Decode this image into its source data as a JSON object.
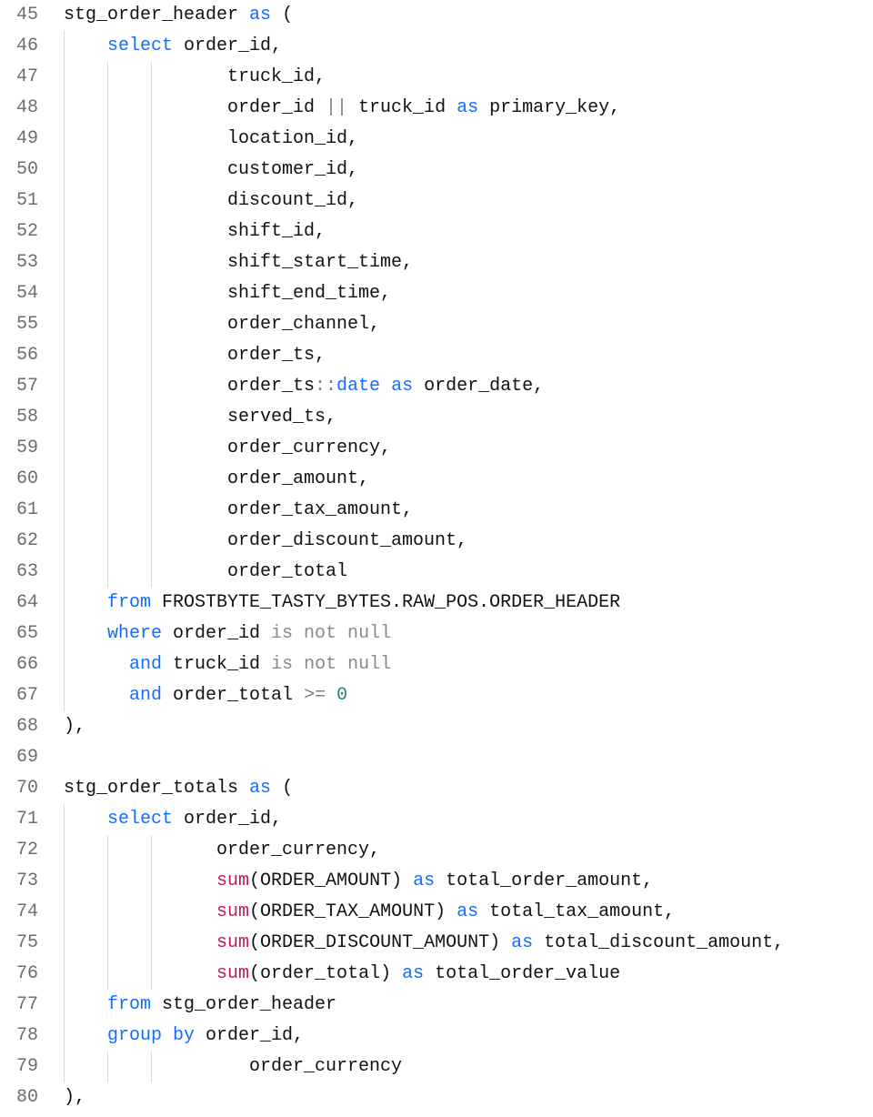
{
  "language": "sql",
  "colors": {
    "keyword": "#126dff",
    "function": "#c2185b",
    "number": "#1d8a7b",
    "null": "#8a8a8a",
    "operator": "#7d7d7d",
    "text": "#111111",
    "gutter": "#6d6d6d",
    "gutter_active": "#1d8a7b",
    "indent_guide": "#d7d7d7"
  },
  "lines": [
    {
      "n": 45,
      "guide": [],
      "tokens": [
        [
          "id",
          "stg_order_header "
        ],
        [
          "kw",
          "as"
        ],
        [
          "punc",
          " ("
        ]
      ]
    },
    {
      "n": 46,
      "guide": [
        1
      ],
      "tokens": [
        [
          "kw",
          "select"
        ],
        [
          "id",
          " order_id"
        ],
        [
          "punc",
          ","
        ]
      ]
    },
    {
      "n": 47,
      "guide": [
        1,
        1,
        1
      ],
      "tokens": [
        [
          "id",
          "   truck_id"
        ],
        [
          "punc",
          ","
        ]
      ]
    },
    {
      "n": 48,
      "guide": [
        1,
        1,
        1
      ],
      "tokens": [
        [
          "id",
          "   order_id "
        ],
        [
          "op",
          "||"
        ],
        [
          "id",
          " truck_id "
        ],
        [
          "kw",
          "as"
        ],
        [
          "id",
          " primary_key"
        ],
        [
          "punc",
          ","
        ]
      ]
    },
    {
      "n": 49,
      "guide": [
        1,
        1,
        1
      ],
      "tokens": [
        [
          "id",
          "   location_id"
        ],
        [
          "punc",
          ","
        ]
      ]
    },
    {
      "n": 50,
      "guide": [
        1,
        1,
        1
      ],
      "tokens": [
        [
          "id",
          "   customer_id"
        ],
        [
          "punc",
          ","
        ]
      ]
    },
    {
      "n": 51,
      "guide": [
        1,
        1,
        1
      ],
      "tokens": [
        [
          "id",
          "   discount_id"
        ],
        [
          "punc",
          ","
        ]
      ]
    },
    {
      "n": 52,
      "guide": [
        1,
        1,
        1
      ],
      "tokens": [
        [
          "id",
          "   shift_id"
        ],
        [
          "punc",
          ","
        ]
      ]
    },
    {
      "n": 53,
      "guide": [
        1,
        1,
        1
      ],
      "tokens": [
        [
          "id",
          "   shift_start_time"
        ],
        [
          "punc",
          ","
        ]
      ]
    },
    {
      "n": 54,
      "guide": [
        1,
        1,
        1
      ],
      "tokens": [
        [
          "id",
          "   shift_end_time"
        ],
        [
          "punc",
          ","
        ]
      ]
    },
    {
      "n": 55,
      "guide": [
        1,
        1,
        1
      ],
      "tokens": [
        [
          "id",
          "   order_channel"
        ],
        [
          "punc",
          ","
        ]
      ]
    },
    {
      "n": 56,
      "guide": [
        1,
        1,
        1
      ],
      "tokens": [
        [
          "id",
          "   order_ts"
        ],
        [
          "punc",
          ","
        ]
      ]
    },
    {
      "n": 57,
      "guide": [
        1,
        1,
        1
      ],
      "tokens": [
        [
          "id",
          "   order_ts"
        ],
        [
          "op",
          "::"
        ],
        [
          "kw",
          "date"
        ],
        [
          "id",
          " "
        ],
        [
          "kw",
          "as"
        ],
        [
          "id",
          " order_date"
        ],
        [
          "punc",
          ","
        ]
      ]
    },
    {
      "n": 58,
      "guide": [
        1,
        1,
        1
      ],
      "tokens": [
        [
          "id",
          "   served_ts"
        ],
        [
          "punc",
          ","
        ]
      ]
    },
    {
      "n": 59,
      "guide": [
        1,
        1,
        1
      ],
      "tokens": [
        [
          "id",
          "   order_currency"
        ],
        [
          "punc",
          ","
        ]
      ]
    },
    {
      "n": 60,
      "guide": [
        1,
        1,
        1
      ],
      "tokens": [
        [
          "id",
          "   order_amount"
        ],
        [
          "punc",
          ","
        ]
      ]
    },
    {
      "n": 61,
      "guide": [
        1,
        1,
        1
      ],
      "tokens": [
        [
          "id",
          "   order_tax_amount"
        ],
        [
          "punc",
          ","
        ]
      ]
    },
    {
      "n": 62,
      "guide": [
        1,
        1,
        1
      ],
      "tokens": [
        [
          "id",
          "   order_discount_amount"
        ],
        [
          "punc",
          ","
        ]
      ]
    },
    {
      "n": 63,
      "guide": [
        1,
        1,
        1
      ],
      "tokens": [
        [
          "id",
          "   order_total"
        ]
      ]
    },
    {
      "n": 64,
      "guide": [
        1
      ],
      "tokens": [
        [
          "kw",
          "from"
        ],
        [
          "id",
          " FROSTBYTE_TASTY_BYTES.RAW_POS.ORDER_HEADER"
        ]
      ]
    },
    {
      "n": 65,
      "guide": [
        1
      ],
      "tokens": [
        [
          "kw",
          "where"
        ],
        [
          "id",
          " order_id "
        ],
        [
          "nul",
          "is not null"
        ]
      ]
    },
    {
      "n": 66,
      "guide": [
        1
      ],
      "tokens": [
        [
          "id",
          "  "
        ],
        [
          "kw",
          "and"
        ],
        [
          "id",
          " truck_id "
        ],
        [
          "nul",
          "is not null"
        ]
      ]
    },
    {
      "n": 67,
      "guide": [
        1
      ],
      "tokens": [
        [
          "id",
          "  "
        ],
        [
          "kw",
          "and"
        ],
        [
          "id",
          " order_total "
        ],
        [
          "op",
          ">="
        ],
        [
          "id",
          " "
        ],
        [
          "num",
          "0"
        ]
      ]
    },
    {
      "n": 68,
      "guide": [],
      "tokens": [
        [
          "punc",
          "),"
        ]
      ]
    },
    {
      "n": 69,
      "guide": [],
      "tokens": [
        [
          "id",
          ""
        ]
      ]
    },
    {
      "n": 70,
      "guide": [],
      "tokens": [
        [
          "id",
          "stg_order_totals "
        ],
        [
          "kw",
          "as"
        ],
        [
          "punc",
          " ("
        ]
      ]
    },
    {
      "n": 71,
      "guide": [
        1
      ],
      "tokens": [
        [
          "kw",
          "select"
        ],
        [
          "id",
          " order_id"
        ],
        [
          "punc",
          ","
        ]
      ]
    },
    {
      "n": 72,
      "guide": [
        1,
        1,
        1
      ],
      "tokens": [
        [
          "id",
          "  order_currency"
        ],
        [
          "punc",
          ","
        ]
      ]
    },
    {
      "n": 73,
      "guide": [
        1,
        1,
        1
      ],
      "tokens": [
        [
          "id",
          "  "
        ],
        [
          "fn",
          "sum"
        ],
        [
          "punc",
          "("
        ],
        [
          "id",
          "ORDER_AMOUNT"
        ],
        [
          "punc",
          ") "
        ],
        [
          "kw",
          "as"
        ],
        [
          "id",
          " total_order_amount"
        ],
        [
          "punc",
          ","
        ]
      ]
    },
    {
      "n": 74,
      "guide": [
        1,
        1,
        1
      ],
      "tokens": [
        [
          "id",
          "  "
        ],
        [
          "fn",
          "sum"
        ],
        [
          "punc",
          "("
        ],
        [
          "id",
          "ORDER_TAX_AMOUNT"
        ],
        [
          "punc",
          ") "
        ],
        [
          "kw",
          "as"
        ],
        [
          "id",
          " total_tax_amount"
        ],
        [
          "punc",
          ","
        ]
      ]
    },
    {
      "n": 75,
      "guide": [
        1,
        1,
        1
      ],
      "tokens": [
        [
          "id",
          "  "
        ],
        [
          "fn",
          "sum"
        ],
        [
          "punc",
          "("
        ],
        [
          "id",
          "ORDER_DISCOUNT_AMOUNT"
        ],
        [
          "punc",
          ") "
        ],
        [
          "kw",
          "as"
        ],
        [
          "id",
          " total_discount_amount"
        ],
        [
          "punc",
          ","
        ]
      ]
    },
    {
      "n": 76,
      "guide": [
        1,
        1,
        1
      ],
      "tokens": [
        [
          "id",
          "  "
        ],
        [
          "fn",
          "sum"
        ],
        [
          "punc",
          "("
        ],
        [
          "id",
          "order_total"
        ],
        [
          "punc",
          ") "
        ],
        [
          "kw",
          "as"
        ],
        [
          "id",
          " total_order_value"
        ]
      ]
    },
    {
      "n": 77,
      "guide": [
        1
      ],
      "tokens": [
        [
          "kw",
          "from"
        ],
        [
          "id",
          " stg_order_header"
        ]
      ]
    },
    {
      "n": 78,
      "guide": [
        1
      ],
      "tokens": [
        [
          "kw",
          "group by"
        ],
        [
          "id",
          " order_id"
        ],
        [
          "punc",
          ","
        ]
      ]
    },
    {
      "n": 79,
      "guide": [
        1,
        1,
        1
      ],
      "tokens": [
        [
          "id",
          "     order_currency"
        ]
      ]
    },
    {
      "n": 80,
      "guide": [],
      "tokens": [
        [
          "punc",
          "),"
        ]
      ]
    }
  ]
}
